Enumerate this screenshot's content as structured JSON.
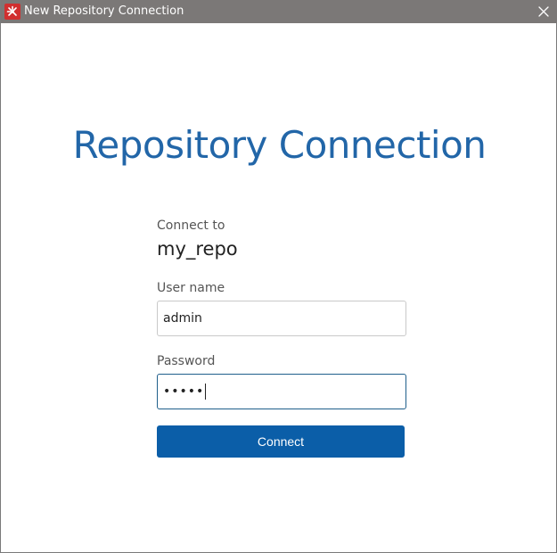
{
  "window": {
    "title": "New Repository Connection"
  },
  "main": {
    "heading": "Repository Connection",
    "connect_to_label": "Connect to",
    "repository_name": "my_repo",
    "username_label": "User name",
    "username_value": "admin",
    "password_label": "Password",
    "password_masked": "•••••",
    "connect_button_label": "Connect"
  },
  "colors": {
    "titlebar": "#7b7877",
    "heading": "#2266a8",
    "button": "#0b5ea8",
    "focus_border": "#1f5f8b"
  },
  "icons": {
    "app_icon": "app-logo-icon",
    "close_icon": "close-icon"
  }
}
